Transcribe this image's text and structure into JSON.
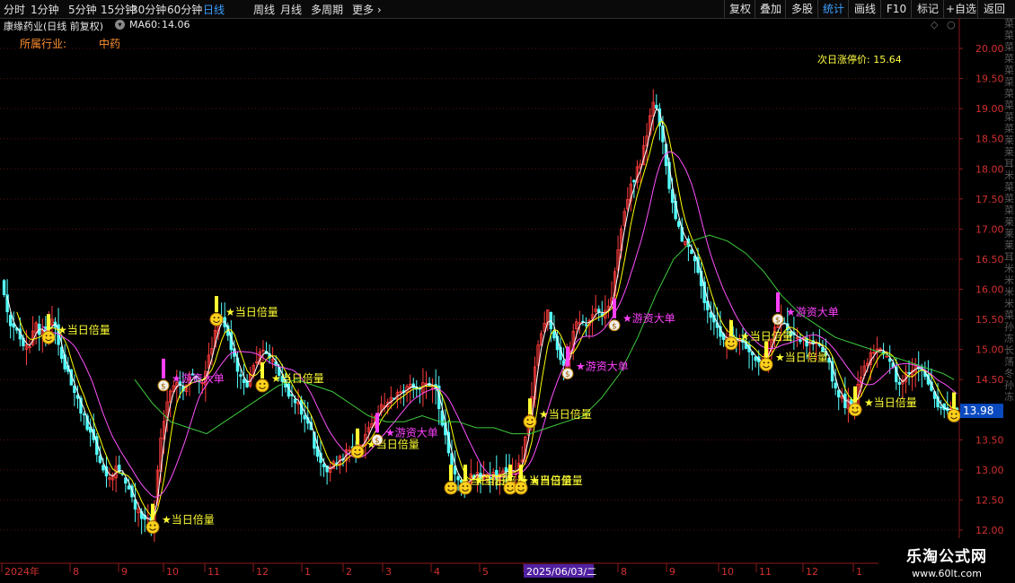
{
  "toolbar": {
    "periods": [
      "分时",
      "1分钟",
      "5分钟",
      "15分钟",
      "30分钟",
      "60分钟",
      "日线",
      "周线",
      "月线",
      "多周期",
      "更多"
    ],
    "active_period": "日线",
    "tools": [
      "复权",
      "叠加",
      "多股",
      "统计",
      "画线",
      "F10",
      "标记",
      "+自选",
      "返回"
    ],
    "active_tool": "统计"
  },
  "stock": {
    "title": "康缘药业(日线 前复权)",
    "ma_label": "MA60:",
    "ma_value": "14.06",
    "industry_label": "所属行业:",
    "industry_value": "中药",
    "limit_label": "次日涨停价:",
    "limit_value": "15.64"
  },
  "colors": {
    "up": "#ff3c3c",
    "down": "#54ffff",
    "ma5": "#ffffff",
    "ma10": "#ffff00",
    "ma20": "#ff50ff",
    "ma60": "#3ccc3c",
    "signal_yellow": "#ffff33",
    "signal_magenta": "#ff40ff",
    "price_box": "#0a4ac0"
  },
  "right_strip_text": "菜菜菜菜菜菜菜菜菜菜莱莱耳米菜菜菜莱莱莱耳米米米米菜孙冻长荡冬孙冻长荡冬",
  "watermark": {
    "line1": "乐淘公式网",
    "line2": "www.60lt.com"
  },
  "chart_data": {
    "type": "candlestick",
    "ylim": [
      11.8,
      20.5
    ],
    "y_ticks": [
      "20.00",
      "19.50",
      "19.00",
      "18.50",
      "18.00",
      "17.50",
      "17.00",
      "16.50",
      "16.00",
      "15.50",
      "15.00",
      "14.50",
      "14.00",
      "13.50",
      "13.00",
      "12.50",
      "12.00"
    ],
    "x_ticks": [
      "2024年",
      "8",
      "9",
      "10",
      "11",
      "12",
      "1",
      "2",
      "3",
      "4",
      "5",
      "2025/06/03/二",
      "8",
      "9",
      "10",
      "11",
      "12",
      "1"
    ],
    "current_price": "13.98",
    "trend": [
      [
        0,
        16.2
      ],
      [
        10,
        15.5
      ],
      [
        20,
        15.3
      ],
      [
        30,
        15.0
      ],
      [
        40,
        15.4
      ],
      [
        50,
        15.2
      ],
      [
        60,
        15.5
      ],
      [
        70,
        14.8
      ],
      [
        80,
        14.4
      ],
      [
        90,
        14.0
      ],
      [
        100,
        13.6
      ],
      [
        110,
        13.2
      ],
      [
        120,
        12.9
      ],
      [
        130,
        13.0
      ],
      [
        140,
        12.8
      ],
      [
        150,
        12.4
      ],
      [
        160,
        12.2
      ],
      [
        170,
        12.1
      ],
      [
        178,
        13.4
      ],
      [
        185,
        14.1
      ],
      [
        195,
        14.5
      ],
      [
        205,
        14.3
      ],
      [
        215,
        14.6
      ],
      [
        225,
        14.4
      ],
      [
        235,
        15.0
      ],
      [
        245,
        15.6
      ],
      [
        255,
        15.2
      ],
      [
        265,
        14.6
      ],
      [
        275,
        14.4
      ],
      [
        285,
        14.8
      ],
      [
        295,
        15.0
      ],
      [
        305,
        14.8
      ],
      [
        315,
        14.4
      ],
      [
        325,
        14.2
      ],
      [
        335,
        14.0
      ],
      [
        345,
        13.7
      ],
      [
        355,
        13.1
      ],
      [
        365,
        13.0
      ],
      [
        375,
        13.1
      ],
      [
        385,
        13.3
      ],
      [
        395,
        13.4
      ],
      [
        405,
        13.5
      ],
      [
        415,
        13.8
      ],
      [
        425,
        14.1
      ],
      [
        435,
        14.2
      ],
      [
        445,
        14.3
      ],
      [
        455,
        14.4
      ],
      [
        465,
        14.4
      ],
      [
        475,
        14.4
      ],
      [
        485,
        14.3
      ],
      [
        495,
        13.6
      ],
      [
        505,
        12.9
      ],
      [
        515,
        12.8
      ],
      [
        525,
        12.9
      ],
      [
        535,
        12.9
      ],
      [
        545,
        12.9
      ],
      [
        555,
        12.9
      ],
      [
        565,
        13.0
      ],
      [
        575,
        13.0
      ],
      [
        583,
        13.3
      ],
      [
        590,
        14.0
      ],
      [
        600,
        15.2
      ],
      [
        610,
        15.6
      ],
      [
        620,
        15.0
      ],
      [
        630,
        14.7
      ],
      [
        640,
        15.4
      ],
      [
        650,
        15.4
      ],
      [
        660,
        15.6
      ],
      [
        670,
        15.6
      ],
      [
        680,
        15.7
      ],
      [
        690,
        16.9
      ],
      [
        700,
        17.6
      ],
      [
        710,
        18.0
      ],
      [
        720,
        18.5
      ],
      [
        728,
        19.2
      ],
      [
        735,
        18.7
      ],
      [
        745,
        17.6
      ],
      [
        755,
        17.0
      ],
      [
        765,
        16.7
      ],
      [
        775,
        16.4
      ],
      [
        785,
        15.8
      ],
      [
        795,
        15.4
      ],
      [
        805,
        15.2
      ],
      [
        815,
        15.2
      ],
      [
        825,
        15.1
      ],
      [
        835,
        14.9
      ],
      [
        845,
        14.8
      ],
      [
        855,
        15.0
      ],
      [
        862,
        15.3
      ],
      [
        870,
        15.5
      ],
      [
        880,
        15.3
      ],
      [
        890,
        15.2
      ],
      [
        900,
        15.1
      ],
      [
        910,
        15.2
      ],
      [
        920,
        14.9
      ],
      [
        930,
        14.3
      ],
      [
        940,
        14.1
      ],
      [
        950,
        14.1
      ],
      [
        960,
        14.6
      ],
      [
        970,
        14.9
      ],
      [
        980,
        15.0
      ],
      [
        990,
        14.9
      ],
      [
        1000,
        14.4
      ],
      [
        1010,
        14.6
      ],
      [
        1020,
        14.7
      ],
      [
        1030,
        14.5
      ],
      [
        1040,
        14.2
      ],
      [
        1050,
        14.0
      ],
      [
        1060,
        14.1
      ],
      [
        1066,
        14.0
      ]
    ],
    "ma60": [
      [
        150,
        14.5
      ],
      [
        170,
        14.1
      ],
      [
        190,
        13.8
      ],
      [
        210,
        13.7
      ],
      [
        230,
        13.6
      ],
      [
        250,
        13.8
      ],
      [
        270,
        14.0
      ],
      [
        290,
        14.2
      ],
      [
        310,
        14.4
      ],
      [
        330,
        14.5
      ],
      [
        350,
        14.4
      ],
      [
        370,
        14.3
      ],
      [
        390,
        14.1
      ],
      [
        410,
        13.9
      ],
      [
        430,
        13.8
      ],
      [
        450,
        13.8
      ],
      [
        470,
        13.9
      ],
      [
        490,
        13.8
      ],
      [
        510,
        13.8
      ],
      [
        530,
        13.7
      ],
      [
        550,
        13.7
      ],
      [
        570,
        13.6
      ],
      [
        590,
        13.6
      ],
      [
        610,
        13.7
      ],
      [
        630,
        13.8
      ],
      [
        650,
        13.9
      ],
      [
        670,
        14.2
      ],
      [
        690,
        14.6
      ],
      [
        710,
        15.2
      ],
      [
        730,
        15.9
      ],
      [
        750,
        16.5
      ],
      [
        770,
        16.8
      ],
      [
        790,
        16.9
      ],
      [
        810,
        16.8
      ],
      [
        830,
        16.6
      ],
      [
        850,
        16.3
      ],
      [
        870,
        15.9
      ],
      [
        890,
        15.6
      ],
      [
        910,
        15.4
      ],
      [
        930,
        15.2
      ],
      [
        950,
        15.1
      ],
      [
        970,
        15.0
      ],
      [
        990,
        14.9
      ],
      [
        1010,
        14.8
      ],
      [
        1030,
        14.7
      ],
      [
        1050,
        14.6
      ],
      [
        1062,
        14.5
      ]
    ],
    "signals": [
      {
        "x": 54,
        "y": 15.2,
        "label": "★当日倍量",
        "kind": "smile"
      },
      {
        "x": 170,
        "y": 12.05,
        "label": "★当日倍量",
        "kind": "smile"
      },
      {
        "x": 182,
        "y": 14.4,
        "label": "★游资大单",
        "kind": "bag"
      },
      {
        "x": 241,
        "y": 15.5,
        "label": "★当日倍量",
        "kind": "smile"
      },
      {
        "x": 292,
        "y": 14.4,
        "label": "★当日倍量",
        "kind": "smile"
      },
      {
        "x": 398,
        "y": 13.3,
        "label": "★当日倍量",
        "kind": "smile"
      },
      {
        "x": 420,
        "y": 13.5,
        "label": "★游资大单",
        "kind": "bag"
      },
      {
        "x": 502,
        "y": 12.7,
        "label": "★当日倍量",
        "kind": "smile"
      },
      {
        "x": 518,
        "y": 12.7,
        "label": "★当日倍量",
        "kind": "smile"
      },
      {
        "x": 568,
        "y": 12.7,
        "label": "★当日倍量",
        "kind": "smile"
      },
      {
        "x": 580,
        "y": 12.7,
        "label": "★当日倍量",
        "kind": "smile"
      },
      {
        "x": 590,
        "y": 13.8,
        "label": "★当日倍量",
        "kind": "smile"
      },
      {
        "x": 632,
        "y": 14.6,
        "label": "★游资大单",
        "kind": "bag"
      },
      {
        "x": 684,
        "y": 15.4,
        "label": "★游资大单",
        "kind": "bag"
      },
      {
        "x": 814,
        "y": 15.1,
        "label": "★当日倍量",
        "kind": "smile"
      },
      {
        "x": 853,
        "y": 14.75,
        "label": "★当日倍量",
        "kind": "smile"
      },
      {
        "x": 866,
        "y": 15.5,
        "label": "★游资大单",
        "kind": "bag"
      },
      {
        "x": 952,
        "y": 14.0,
        "label": "★当日倍量",
        "kind": "smile"
      },
      {
        "x": 1062,
        "y": 13.9,
        "label": "",
        "kind": "smile"
      }
    ]
  }
}
